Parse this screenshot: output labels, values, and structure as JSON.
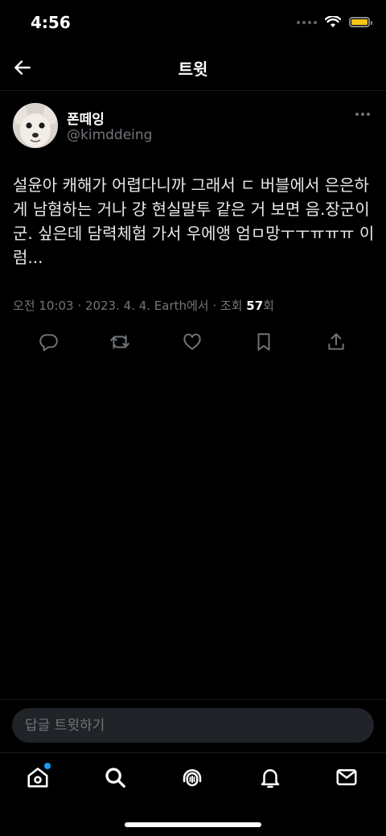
{
  "status_bar": {
    "time": "4:56"
  },
  "header": {
    "title": "트윗"
  },
  "tweet": {
    "author_name": "폰떼잉",
    "author_handle": "@kimddeing",
    "text": "설윤아 캐해가 어렵다니까 그래서 ㄷ 버블에서 은은하게 남혐하는 거나 걍 현실말투 같은 거 보면 음.장군이군. 싶은데 담력체험 가서 우에앵 엄ㅁ망ㅜㅜㅠㅠㅠ 이럼...",
    "meta_prefix": "오전 10:03 · 2023. 4. 4. Earth에서 · 조회 ",
    "views": "57",
    "meta_suffix": "회"
  },
  "reply": {
    "placeholder": "답글 트윗하기"
  },
  "colors": {
    "background": "#000000",
    "secondary_text": "#71767b",
    "accent": "#1d9bf0",
    "battery": "#f5c518"
  },
  "icons": [
    "back-arrow-icon",
    "more-icon",
    "reply-icon",
    "retweet-icon",
    "like-icon",
    "bookmark-icon",
    "share-icon",
    "home-icon",
    "search-icon",
    "spaces-icon",
    "notifications-icon",
    "messages-icon"
  ]
}
